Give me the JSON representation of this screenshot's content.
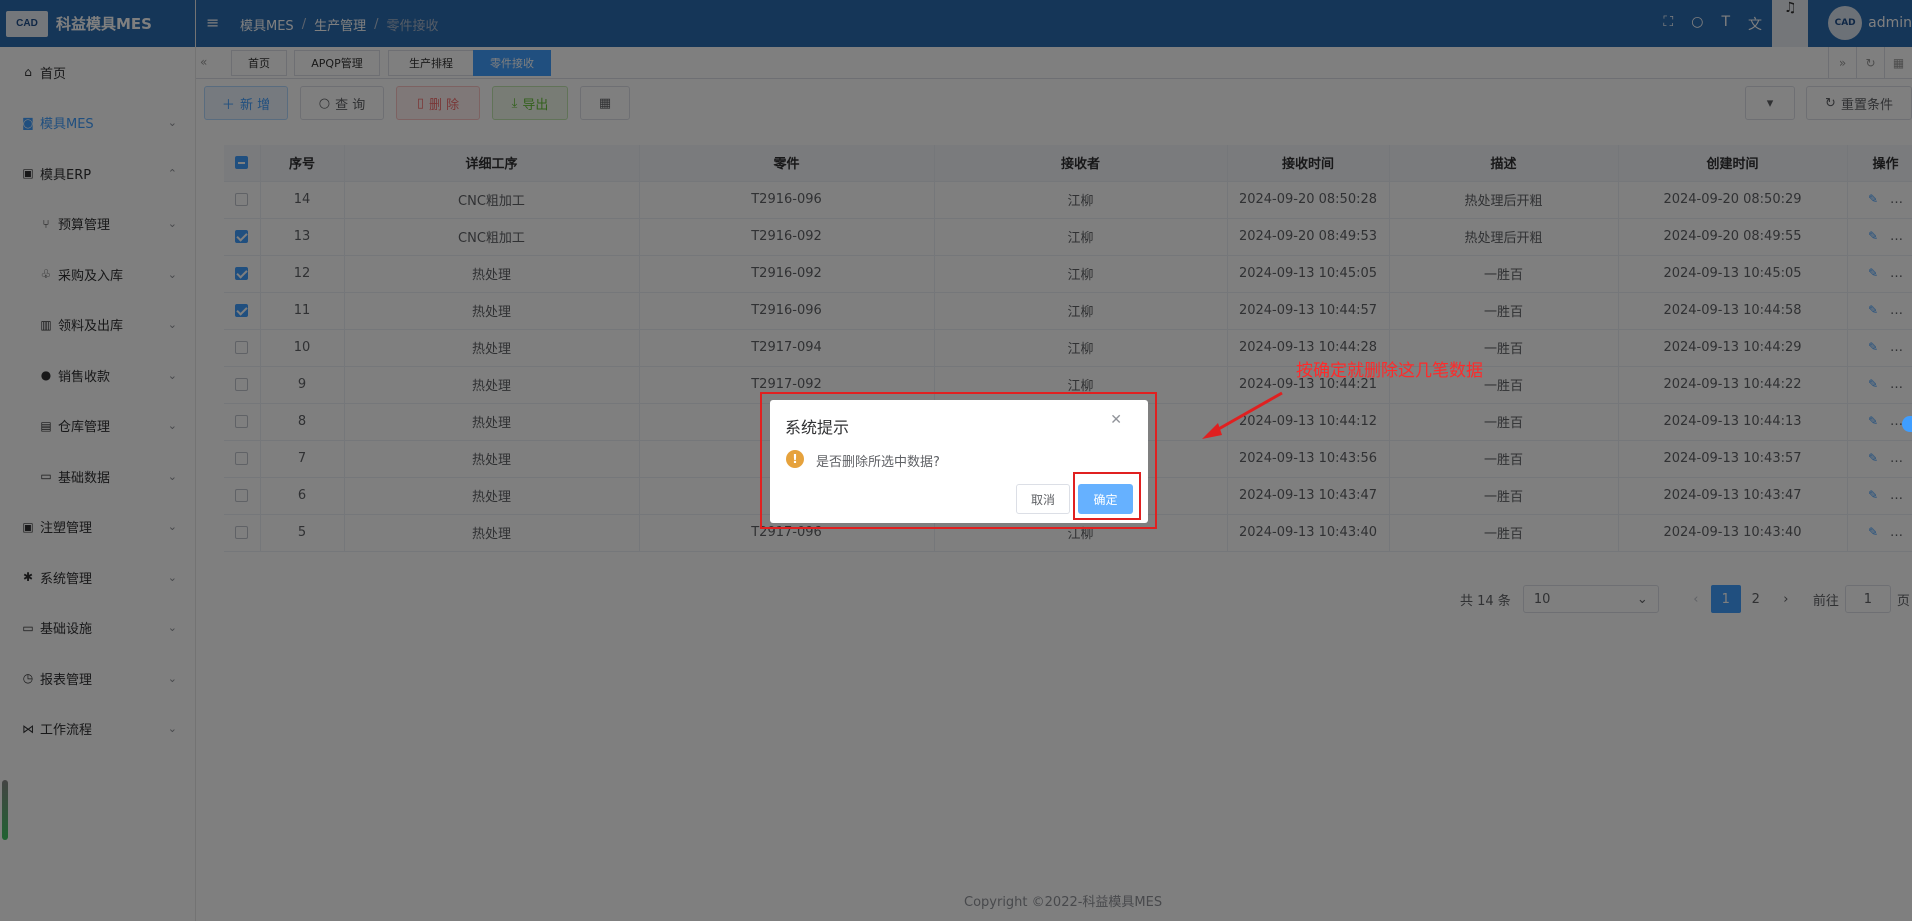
{
  "app": {
    "logo_badge": "CAD",
    "name": "科益模具MES"
  },
  "header": {
    "breadcrumb": [
      "模具MES",
      "生产管理",
      "零件接收"
    ],
    "separator": "/",
    "user": "admin",
    "avatar_badge": "CAD"
  },
  "sidebar": {
    "items": [
      {
        "label": "首页"
      },
      {
        "label": "模具MES"
      },
      {
        "label": "模具ERP"
      },
      {
        "label": "预算管理"
      },
      {
        "label": "采购及入库"
      },
      {
        "label": "领料及出库"
      },
      {
        "label": "销售收款"
      },
      {
        "label": "仓库管理"
      },
      {
        "label": "基础数据"
      },
      {
        "label": "注塑管理"
      },
      {
        "label": "系统管理"
      },
      {
        "label": "基础设施"
      },
      {
        "label": "报表管理"
      },
      {
        "label": "工作流程"
      }
    ]
  },
  "tabs": [
    "首页",
    "APQP管理",
    "生产排程",
    "零件接收"
  ],
  "toolbar": {
    "add": "新 增",
    "query": "查 询",
    "delete": "删 除",
    "export": "导出",
    "reset": "重置条件"
  },
  "table": {
    "columns": [
      "序号",
      "详细工序",
      "零件",
      "接收者",
      "接收时间",
      "描述",
      "创建时间",
      "操作"
    ],
    "rows": [
      {
        "checked": false,
        "no": "14",
        "process": "CNC粗加工",
        "part": "T2916-096",
        "receiver": "江柳",
        "recv_time": "2024-09-20 08:50:28",
        "desc": "热处理后开粗",
        "created": "2024-09-20 08:50:29"
      },
      {
        "checked": true,
        "no": "13",
        "process": "CNC粗加工",
        "part": "T2916-092",
        "receiver": "江柳",
        "recv_time": "2024-09-20 08:49:53",
        "desc": "热处理后开粗",
        "created": "2024-09-20 08:49:55"
      },
      {
        "checked": true,
        "no": "12",
        "process": "热处理",
        "part": "T2916-092",
        "receiver": "江柳",
        "recv_time": "2024-09-13 10:45:05",
        "desc": "一胜百",
        "created": "2024-09-13 10:45:05"
      },
      {
        "checked": true,
        "no": "11",
        "process": "热处理",
        "part": "T2916-096",
        "receiver": "江柳",
        "recv_time": "2024-09-13 10:44:57",
        "desc": "一胜百",
        "created": "2024-09-13 10:44:58"
      },
      {
        "checked": false,
        "no": "10",
        "process": "热处理",
        "part": "T2917-094",
        "receiver": "江柳",
        "recv_time": "2024-09-13 10:44:28",
        "desc": "一胜百",
        "created": "2024-09-13 10:44:29"
      },
      {
        "checked": false,
        "no": "9",
        "process": "热处理",
        "part": "T2917-092",
        "receiver": "江柳",
        "recv_time": "2024-09-13 10:44:21",
        "desc": "一胜百",
        "created": "2024-09-13 10:44:22"
      },
      {
        "checked": false,
        "no": "8",
        "process": "热处理",
        "part": "T2",
        "receiver": "江柳",
        "recv_time": "2024-09-13 10:44:12",
        "desc": "一胜百",
        "created": "2024-09-13 10:44:13"
      },
      {
        "checked": false,
        "no": "7",
        "process": "热处理",
        "part": "T2",
        "receiver": "江柳",
        "recv_time": "2024-09-13 10:43:56",
        "desc": "一胜百",
        "created": "2024-09-13 10:43:57"
      },
      {
        "checked": false,
        "no": "6",
        "process": "热处理",
        "part": "T2",
        "receiver": "江柳",
        "recv_time": "2024-09-13 10:43:47",
        "desc": "一胜百",
        "created": "2024-09-13 10:43:47"
      },
      {
        "checked": false,
        "no": "5",
        "process": "热处理",
        "part": "T2917-096",
        "receiver": "江柳",
        "recv_time": "2024-09-13 10:43:40",
        "desc": "一胜百",
        "created": "2024-09-13 10:43:40"
      }
    ]
  },
  "pagination": {
    "total": "共 14 条",
    "page_size": "10",
    "pages": [
      "1",
      "2"
    ],
    "goto_label": "前往",
    "goto_value": "1",
    "page_suffix": "页"
  },
  "footer": "Copyright ©2022-科益模具MES",
  "dialog": {
    "title": "系统提示",
    "message": "是否删除所选中数据?",
    "cancel": "取消",
    "confirm": "确定"
  },
  "annotation": {
    "text": "按确定就删除这几笔数据",
    "color": "#ff2a2a"
  },
  "colors": {
    "primary": "#409eff",
    "header": "#2b6cb0",
    "danger": "#f56c6c",
    "success": "#67c23a",
    "warning": "#e6a23c"
  }
}
